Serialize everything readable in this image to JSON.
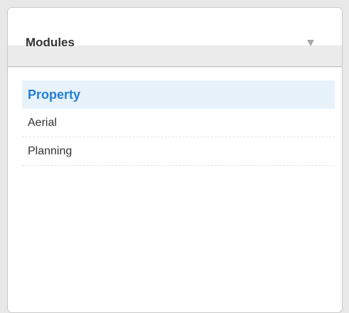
{
  "panel": {
    "title": "Modules",
    "toggle_icon": "chevron-down-icon",
    "items": [
      {
        "label": "Property",
        "selected": true
      },
      {
        "label": "Aerial",
        "selected": false
      },
      {
        "label": "Planning",
        "selected": false
      }
    ]
  },
  "colors": {
    "accent": "#1f7fd6",
    "selected_bg": "#e8f2fb",
    "header_band": "#ececec"
  }
}
